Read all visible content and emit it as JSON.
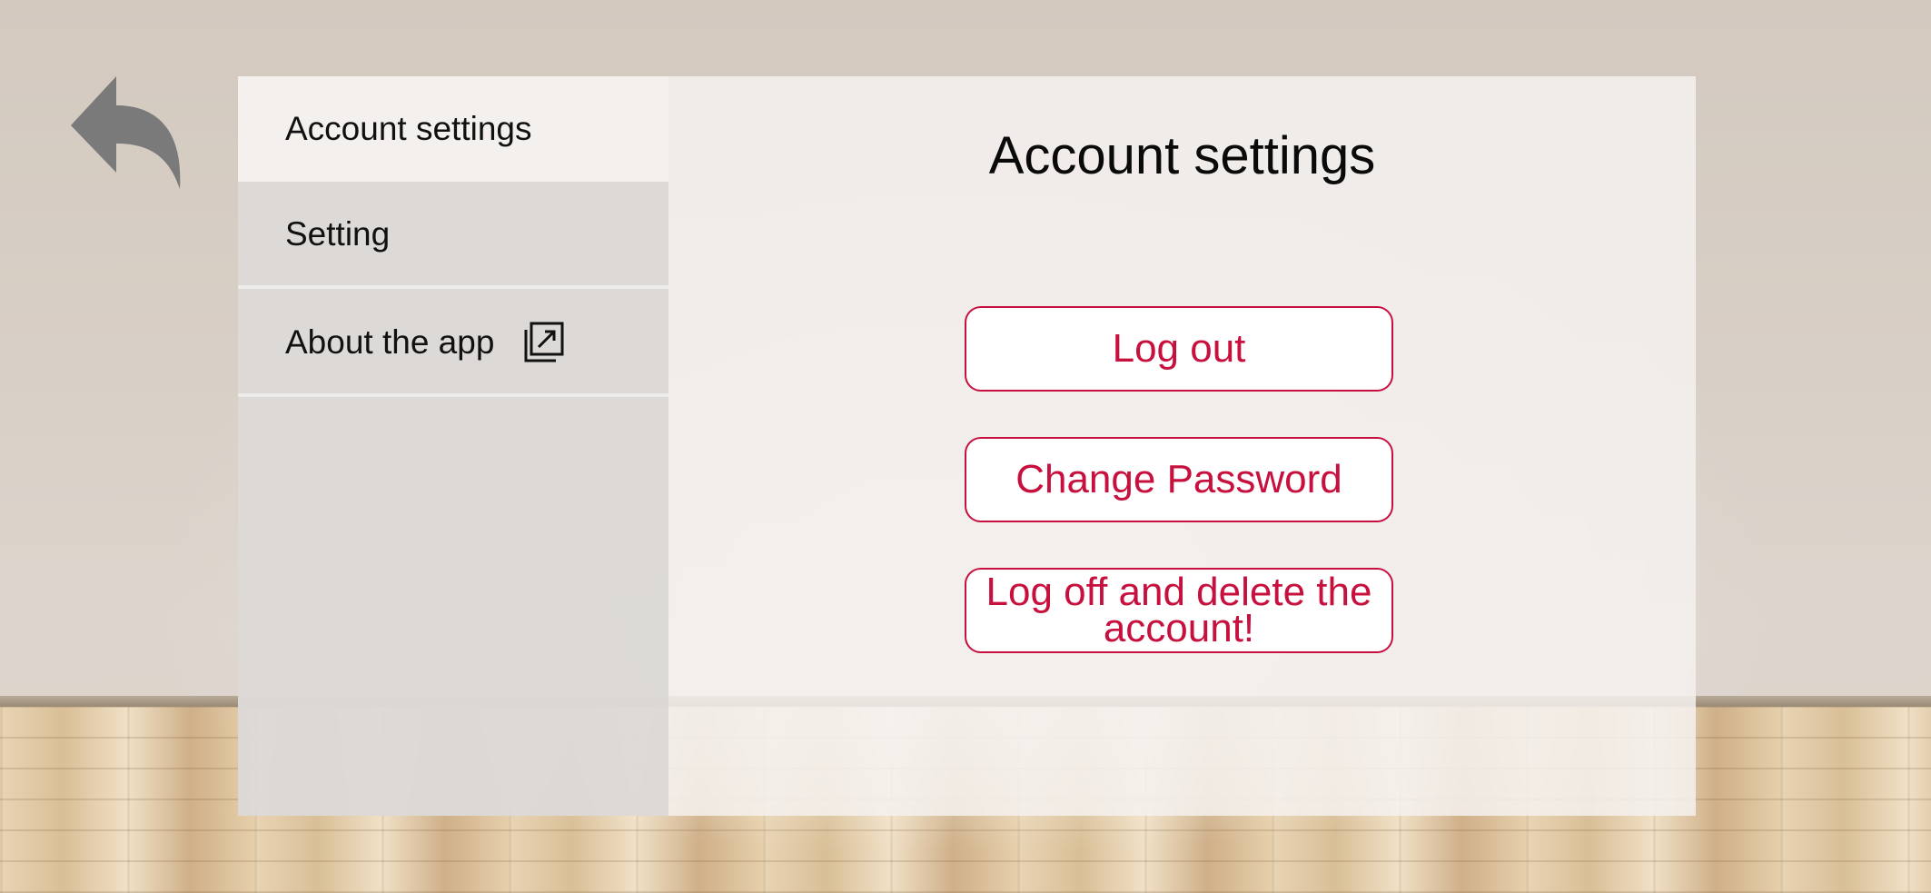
{
  "navigation": {
    "back_icon": "undo-arrow-icon"
  },
  "sidebar": {
    "items": [
      {
        "label": "Account settings",
        "active": true
      },
      {
        "label": "Setting",
        "active": false
      },
      {
        "label": "About the app",
        "active": false,
        "icon": "external-link-icon"
      }
    ]
  },
  "main": {
    "title": "Account settings",
    "buttons": {
      "logout": "Log out",
      "change_password": "Change Password",
      "delete_account": "Log off and delete the account!"
    }
  },
  "colors": {
    "accent": "#c8103e",
    "panel": "#f3f0ee",
    "sidebar": "#d8d6d3",
    "icon_gray": "#7a7a7a"
  }
}
